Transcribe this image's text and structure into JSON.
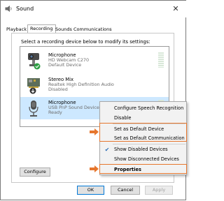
{
  "window": {
    "title": "Sound",
    "close_glyph": "✕"
  },
  "tabs": [
    {
      "label": "Playback",
      "active": false
    },
    {
      "label": "Recording",
      "active": true
    },
    {
      "label": "Sounds",
      "active": false
    },
    {
      "label": "Communications",
      "active": false
    }
  ],
  "instruction": "Select a recording device below to modify its settings:",
  "devices": [
    {
      "name": "Microphone",
      "line1": "HD Webcam C270",
      "line2": "Default Device",
      "icon": "webcam-microphone-icon",
      "status_icon": "green-check-icon",
      "selected": false
    },
    {
      "name": "Stereo Mix",
      "line1": "Realtek High Definition Audio",
      "line2": "Disabled",
      "icon": "soundcard-icon",
      "status_icon": "disabled-arrow-icon",
      "selected": false
    },
    {
      "name": "Microphone",
      "line1": "USB PnP Sound Device",
      "line2": "Ready",
      "icon": "microphone-icon",
      "status_icon": "",
      "selected": true
    }
  ],
  "buttons": {
    "configure": "Configure",
    "ok": "OK",
    "cancel": "Cancel",
    "apply": "Apply"
  },
  "context_menu": {
    "items": [
      {
        "label": "Configure Speech Recognition",
        "checked": false,
        "bold": false
      },
      {
        "label": "Disable",
        "checked": false,
        "bold": false
      },
      {
        "label": "Set as Default Device",
        "checked": false,
        "bold": false,
        "highlighted": true
      },
      {
        "label": "Set as Default Communication Device",
        "checked": false,
        "bold": false,
        "highlighted": true
      },
      {
        "label": "Show Disabled Devices",
        "checked": true,
        "bold": false
      },
      {
        "label": "Show Disconnected Devices",
        "checked": false,
        "bold": false
      },
      {
        "label": "Properties",
        "checked": false,
        "bold": true,
        "highlighted": true
      }
    ]
  },
  "colors": {
    "selection": "#cde8ff",
    "annotation": "#e6762d",
    "check": "#2f6fb7"
  }
}
